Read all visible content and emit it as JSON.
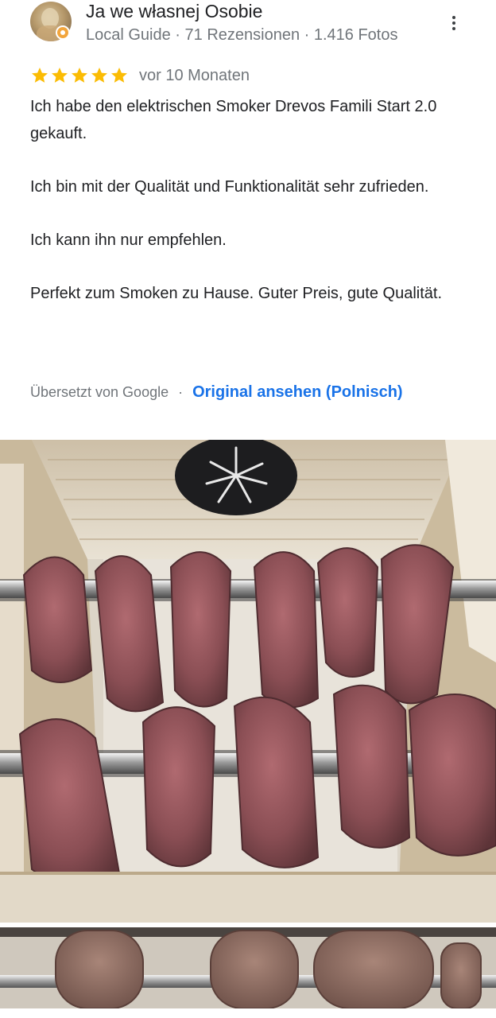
{
  "review": {
    "author_name": "Ja we własnej Osobie",
    "author_meta": "Local Guide · 71 Rezensionen · 1.416 Fotos",
    "rating": 5,
    "rating_max": 5,
    "time_ago": "vor 10 Monaten",
    "paragraphs": [
      "Ich habe den elektrischen Smoker Drevos Famili Start 2.0 gekauft.",
      "Ich bin mit der Qualität und Funktionalität sehr zufrieden.",
      "Ich kann ihn nur empfehlen.",
      "Perfekt zum Smoken zu Hause. Guter Preis, gute Qualität."
    ],
    "translated_by": "Übersetzt von Google",
    "separator": "·",
    "original_link": "Original ansehen (Polnisch)"
  },
  "icons": {
    "avatar": "author-avatar",
    "badge": "local-guide-badge-icon",
    "more": "more-vert-icon",
    "star": "star-icon"
  },
  "colors": {
    "star": "#fbbc04",
    "link": "#1a73e8",
    "secondary_text": "#70757a",
    "primary_text": "#202124"
  }
}
